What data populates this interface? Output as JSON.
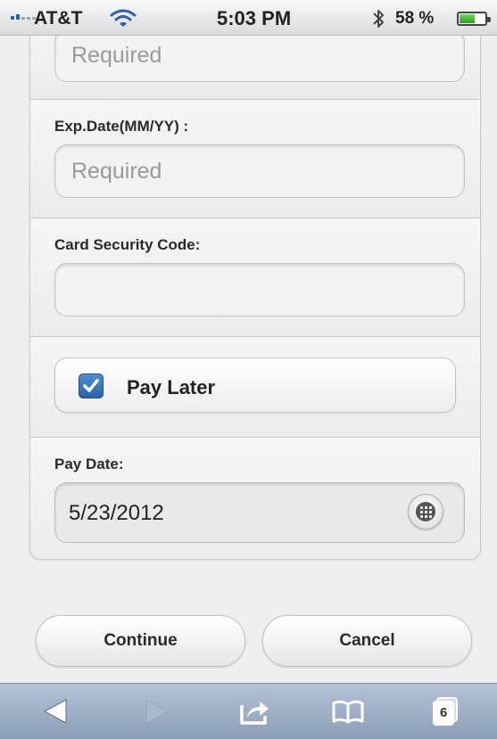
{
  "status_bar": {
    "carrier": "AT&T",
    "time": "5:03 PM",
    "battery_percent": "58 %",
    "battery_level": 0.58
  },
  "form": {
    "card_number": {
      "placeholder": "Required",
      "value": ""
    },
    "exp_date": {
      "label": "Exp.Date(MM/YY) :",
      "placeholder": "Required",
      "value": ""
    },
    "security_code": {
      "label": "Card Security Code:",
      "placeholder": "",
      "value": ""
    },
    "pay_later": {
      "label": "Pay Later",
      "checked": true
    },
    "pay_date": {
      "label": "Pay Date:",
      "value": "5/23/2012"
    }
  },
  "actions": {
    "continue_label": "Continue",
    "cancel_label": "Cancel"
  },
  "browser_toolbar": {
    "pages_count": "6",
    "icons": [
      "back-arrow-icon",
      "forward-arrow-icon",
      "share-icon",
      "bookmarks-icon",
      "pages-icon"
    ]
  },
  "colors": {
    "checkbox_accent": "#3a78bd",
    "toolbar_background": "#9fb0c8",
    "battery_green": "#3fb52d"
  }
}
